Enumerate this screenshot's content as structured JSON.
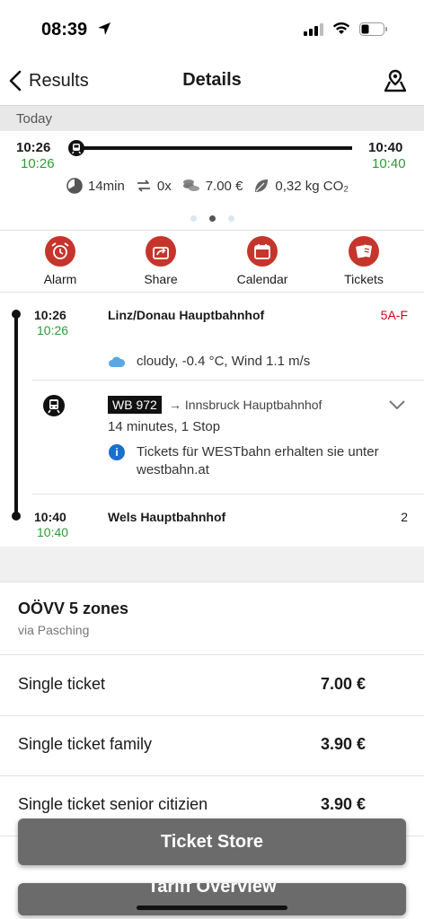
{
  "status_bar": {
    "time": "08:39"
  },
  "nav": {
    "back_label": "Results",
    "title": "Details"
  },
  "day_label": "Today",
  "summary": {
    "dep_time": "10:26",
    "dep_realtime": "10:26",
    "arr_time": "10:40",
    "arr_realtime": "10:40",
    "duration": "14min",
    "transfers": "0x",
    "price": "7.00 €",
    "co2": "0,32 kg CO₂"
  },
  "actions": [
    {
      "label": "Alarm",
      "icon": "alarm-clock-icon"
    },
    {
      "label": "Share",
      "icon": "share-icon"
    },
    {
      "label": "Calendar",
      "icon": "calendar-icon"
    },
    {
      "label": "Tickets",
      "icon": "tickets-icon"
    }
  ],
  "itinerary": {
    "origin": {
      "time": "10:26",
      "realtime": "10:26",
      "name": "Linz/Donau Hauptbahnhof",
      "platform": "5A-F"
    },
    "weather": "cloudy, -0.4 °C, Wind 1.1 m/s",
    "leg": {
      "line": "WB 972",
      "direction": "Innsbruck Hauptbahnhof",
      "duration": "14 minutes, 1 Stop",
      "info": "Tickets für WESTbahn erhalten sie unter westbahn.at"
    },
    "destination": {
      "time": "10:40",
      "realtime": "10:40",
      "name": "Wels Hauptbahnhof",
      "platform": "2"
    }
  },
  "tariff": {
    "title": "OÖVV 5 zones",
    "subtitle": "via Pasching",
    "tickets": [
      {
        "name": "Single ticket",
        "price": "7.00 €"
      },
      {
        "name": "Single ticket family",
        "price": "3.90 €"
      },
      {
        "name": "Single ticket senior citizien",
        "price": "3.90 €"
      }
    ]
  },
  "buttons": {
    "store": "Ticket Store",
    "overview": "Tariff Overview"
  },
  "colors": {
    "accent": "#c5352c",
    "realtime": "#2e9a36",
    "platform_changed": "#d0021b",
    "info": "#1a6fc9"
  }
}
